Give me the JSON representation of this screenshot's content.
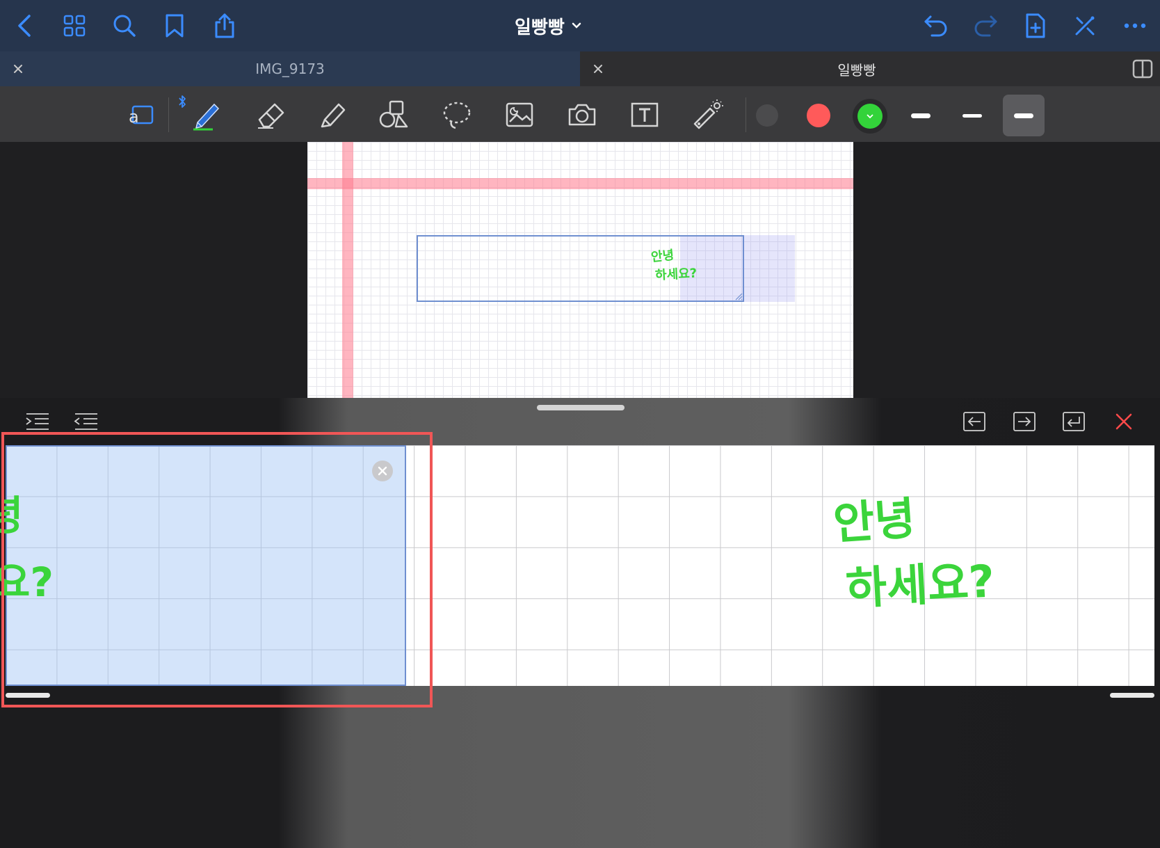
{
  "header": {
    "doc_title": "일빵빵"
  },
  "tabs": [
    {
      "label": "IMG_9173"
    },
    {
      "label": "일빵빵"
    }
  ],
  "canvas": {
    "handwriting_line1": "안녕",
    "handwriting_line2": "하세요?"
  },
  "strip": {
    "big_line1": "안녕",
    "big_line2": "하세요?",
    "cut_line1": "녕",
    "cut_line2": "요?"
  },
  "colors": {
    "accent": "#3b8cff",
    "nav_bg": "#26354d",
    "swatch_gray": "#4b4b4d",
    "swatch_red": "#ff5a5a",
    "swatch_green": "#33d33a",
    "ink_green": "#3bd43b",
    "highlight_red": "#f05656"
  },
  "icons": {
    "nav": [
      "back-chevron-icon",
      "grid-icon",
      "search-icon",
      "bookmark-icon",
      "share-icon",
      "undo-icon",
      "redo-icon",
      "add-page-icon",
      "tools-icon",
      "more-icon"
    ],
    "toolbar": [
      "read-mode-icon",
      "bluetooth-icon",
      "pen-icon",
      "eraser-icon",
      "highlighter-icon",
      "shapes-icon",
      "lasso-icon",
      "image-icon",
      "camera-icon",
      "textbox-icon",
      "laser-pointer-icon"
    ],
    "panel": [
      "indent-icon",
      "outdent-icon",
      "move-left-icon",
      "move-right-icon",
      "new-line-icon",
      "close-icon"
    ]
  }
}
